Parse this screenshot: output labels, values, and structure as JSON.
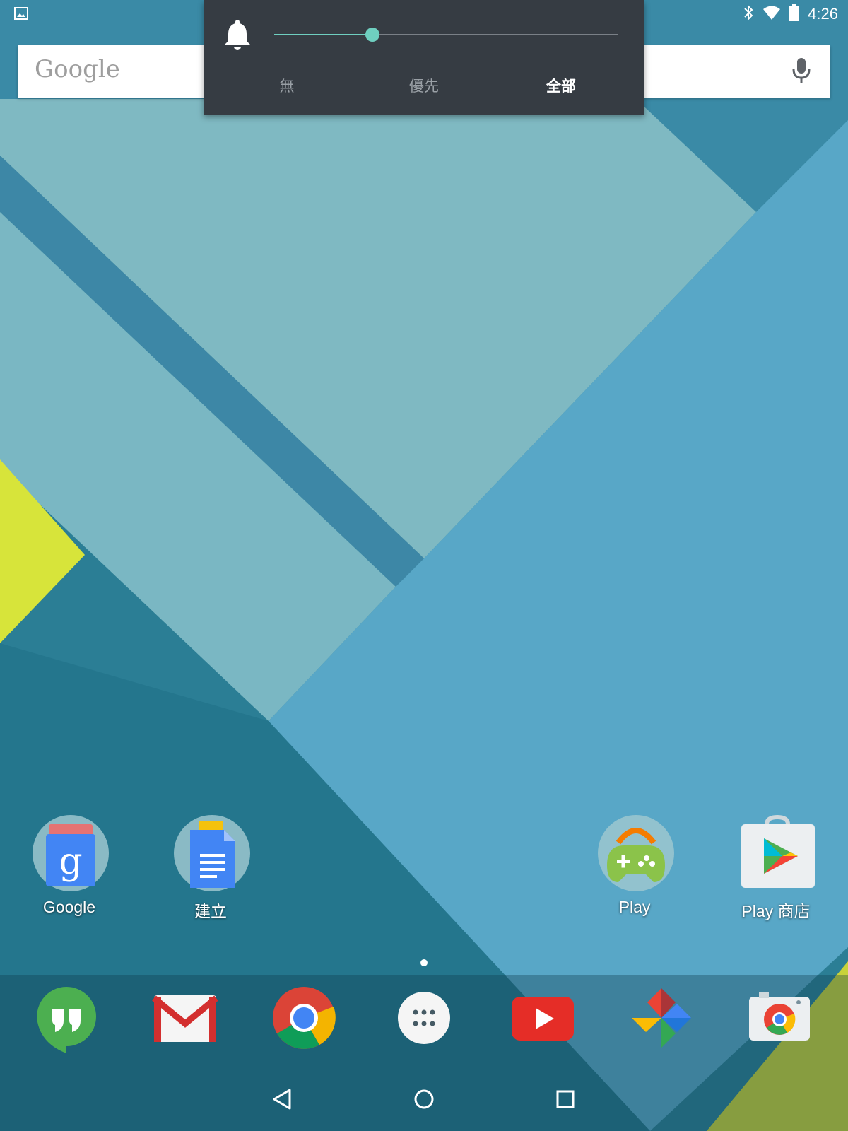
{
  "status_bar": {
    "time": "4:26",
    "icons": [
      "image-notification-icon",
      "bluetooth-icon",
      "wifi-icon",
      "battery-icon"
    ]
  },
  "search_widget": {
    "logo": "Google",
    "mic_icon": "mic-icon"
  },
  "volume_panel": {
    "icon": "bell-icon",
    "volume_level": 0.287,
    "accent_color": "#6fcfc0",
    "modes": [
      {
        "label": "無",
        "selected": false
      },
      {
        "label": "優先",
        "selected": false
      },
      {
        "label": "全部",
        "selected": true
      }
    ]
  },
  "home_apps": [
    {
      "label": "Google",
      "icon": "google-folder-icon"
    },
    {
      "label": "建立",
      "icon": "docs-folder-icon"
    },
    {
      "label": "Play",
      "icon": "play-games-icon"
    },
    {
      "label": "Play 商店",
      "icon": "play-store-icon"
    }
  ],
  "page_indicator": {
    "pages": 1,
    "current": 1
  },
  "dock": [
    {
      "icon": "hangouts-icon"
    },
    {
      "icon": "gmail-icon"
    },
    {
      "icon": "chrome-icon"
    },
    {
      "icon": "app-drawer-icon"
    },
    {
      "icon": "youtube-icon"
    },
    {
      "icon": "photos-icon"
    },
    {
      "icon": "camera-icon"
    }
  ],
  "nav_bar": {
    "buttons": [
      "back-icon",
      "home-icon",
      "recents-icon"
    ]
  }
}
